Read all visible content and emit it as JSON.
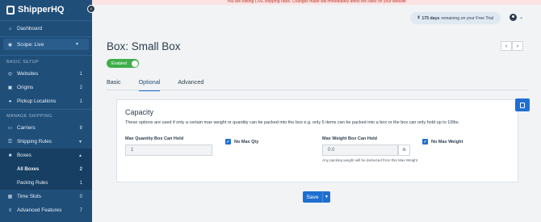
{
  "app": {
    "name": "ShipperHQ"
  },
  "banner": {
    "text": "You are editing LIVE shipping rates. Changes made will immediately affect the rates on your website"
  },
  "trial": {
    "days": "175 days",
    "suffix": "remaining on your Free Trial"
  },
  "sidebar": {
    "dashboard": "Dashboard",
    "scope": "Scope: Live",
    "basic_setup_label": "BASIC SETUP",
    "websites": {
      "label": "Websites",
      "count": "1"
    },
    "origins": {
      "label": "Origins",
      "count": "2"
    },
    "pickup": {
      "label": "Pickup Locations",
      "count": "1"
    },
    "manage_label": "MANAGE SHIPPING",
    "carriers": {
      "label": "Carriers",
      "count": "8"
    },
    "shipping_rules": {
      "label": "Shipping Rules"
    },
    "boxes": {
      "label": "Boxes"
    },
    "all_boxes": {
      "label": "All Boxes",
      "count": "2"
    },
    "packing_rules": {
      "label": "Packing Rules",
      "count": "1"
    },
    "time_slots": {
      "label": "Time Slots",
      "count": "0"
    },
    "advanced": {
      "label": "Advanced Features",
      "count": "7"
    }
  },
  "page": {
    "title": "Box: Small Box",
    "status": "Enabled",
    "tabs": [
      "Basic",
      "Optional",
      "Advanced"
    ],
    "active_tab": "Optional"
  },
  "card": {
    "title": "Capacity",
    "description": "These options are used if only a certain max weight or quantity can be packed into the box e.g. only 5 items can be packed into a box or the box can only hold up to 10lbs.",
    "max_qty_label": "Max Quantity Box Can Hold",
    "max_qty_value": "1",
    "no_max_qty": "No Max Qty",
    "max_weight_label": "Max Weight Box Can Hold",
    "max_weight_value": "0.0",
    "weight_unit": "lb",
    "no_max_weight": "No Max Weight",
    "weight_hint": "Any packing weight will be deducted from this Max Weight"
  },
  "actions": {
    "save": "Save"
  },
  "colors": {
    "sidebar": "#1f4e79",
    "primary": "#1f6fd1",
    "enabled": "#3fae49"
  }
}
